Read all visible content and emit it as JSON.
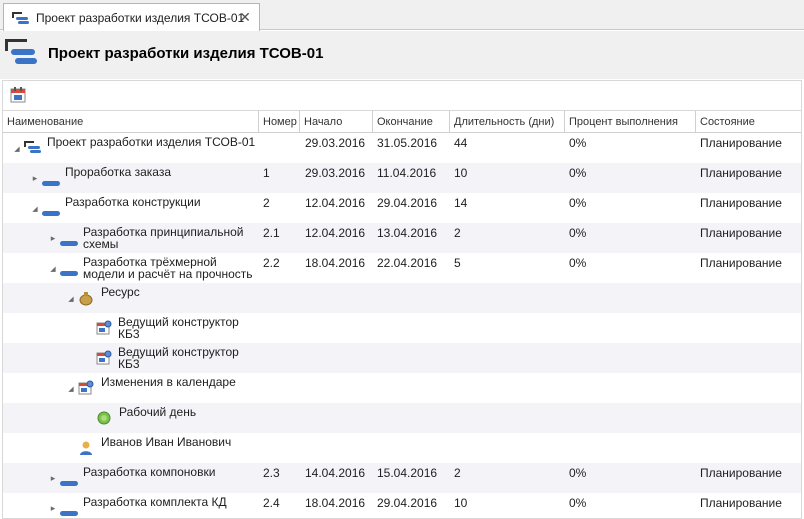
{
  "tab": {
    "title": "Проект разработки изделия ТСОВ-01",
    "close": "✕"
  },
  "header": {
    "title": "Проект разработки изделия ТСОВ-01"
  },
  "grid": {
    "columns": [
      "Наименование",
      "Номер",
      "Начало",
      "Окончание",
      "Длительность (дни)",
      "Процент выполнения",
      "Состояние"
    ],
    "rows": [
      {
        "name": "Проект разработки изделия ТСОВ-01",
        "number": "",
        "start": "29.03.2016",
        "end": "31.05.2016",
        "duration": "44",
        "percent": "0%",
        "state": "Планирование",
        "icon": "project-icon",
        "expander": "expanded"
      },
      {
        "name": "Проработка заказа",
        "number": "1",
        "start": "29.03.2016",
        "end": "11.04.2016",
        "duration": "10",
        "percent": "0%",
        "state": "Планирование",
        "icon": "task-icon",
        "expander": "collapsed"
      },
      {
        "name": "Разработка конструкции",
        "number": "2",
        "start": "12.04.2016",
        "end": "29.04.2016",
        "duration": "14",
        "percent": "0%",
        "state": "Планирование",
        "icon": "task-icon",
        "expander": "expanded"
      },
      {
        "name": "Разработка принципиальной схемы",
        "number": "2.1",
        "start": "12.04.2016",
        "end": "13.04.2016",
        "duration": "2",
        "percent": "0%",
        "state": "Планирование",
        "icon": "task-icon",
        "expander": "collapsed"
      },
      {
        "name": "Разработка трёхмерной модели и расчёт на прочность",
        "number": "2.2",
        "start": "18.04.2016",
        "end": "22.04.2016",
        "duration": "5",
        "percent": "0%",
        "state": "Планирование",
        "icon": "task-icon",
        "expander": "expanded"
      },
      {
        "name": "Ресурс",
        "number": "",
        "start": "",
        "end": "",
        "duration": "",
        "percent": "",
        "state": "",
        "icon": "resource-bag-icon",
        "expander": "expanded"
      },
      {
        "name": "Ведущий конструктор КБ3",
        "number": "",
        "start": "",
        "end": "",
        "duration": "",
        "percent": "",
        "state": "",
        "icon": "role-calendar-icon",
        "expander": "none"
      },
      {
        "name": "Ведущий конструктор КБ3",
        "number": "",
        "start": "",
        "end": "",
        "duration": "",
        "percent": "",
        "state": "",
        "icon": "role-calendar-icon",
        "expander": "none"
      },
      {
        "name": "Изменения в календаре",
        "number": "",
        "start": "",
        "end": "",
        "duration": "",
        "percent": "",
        "state": "",
        "icon": "calendar-change-icon",
        "expander": "expanded"
      },
      {
        "name": "Рабочий день",
        "number": "",
        "start": "",
        "end": "",
        "duration": "",
        "percent": "",
        "state": "",
        "icon": "workday-icon",
        "expander": "none"
      },
      {
        "name": "Иванов Иван Иванович",
        "number": "",
        "start": "",
        "end": "",
        "duration": "",
        "percent": "",
        "state": "",
        "icon": "person-icon",
        "expander": "none"
      },
      {
        "name": "Разработка компоновки",
        "number": "2.3",
        "start": "14.04.2016",
        "end": "15.04.2016",
        "duration": "2",
        "percent": "0%",
        "state": "Планирование",
        "icon": "task-icon",
        "expander": "collapsed"
      },
      {
        "name": "Разработка комплекта КД",
        "number": "2.4",
        "start": "18.04.2016",
        "end": "29.04.2016",
        "duration": "10",
        "percent": "0%",
        "state": "Планирование",
        "icon": "task-icon",
        "expander": "collapsed"
      }
    ]
  }
}
